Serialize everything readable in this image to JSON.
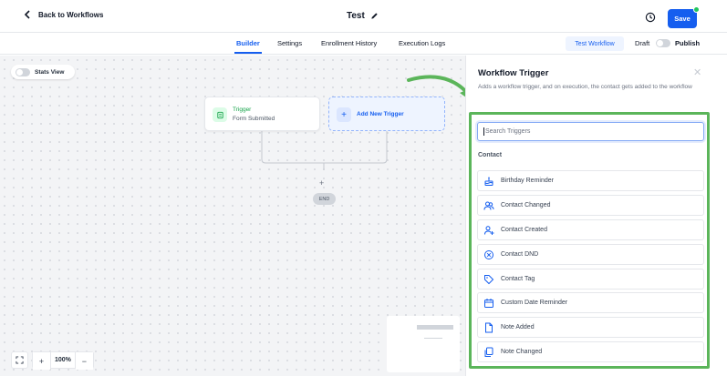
{
  "header": {
    "back_label": "Back to Workflows",
    "title": "Test",
    "save_label": "Save"
  },
  "tabs": [
    {
      "label": "Builder",
      "active": true
    },
    {
      "label": "Settings"
    },
    {
      "label": "Enrollment History"
    },
    {
      "label": "Execution Logs"
    }
  ],
  "actions": {
    "test_workflow": "Test Workflow",
    "draft": "Draft",
    "publish": "Publish"
  },
  "canvas": {
    "stats_view": "Stats View",
    "trigger_node": {
      "title": "Trigger",
      "subtitle": "Form Submitted"
    },
    "add_trigger": "Add New Trigger",
    "end_label": "END",
    "zoom_level": "100%"
  },
  "panel": {
    "title": "Workflow Trigger",
    "description": "Adds a workflow trigger, and on execution, the contact gets added to the workflow",
    "search_placeholder": "Search Triggers",
    "section": "Contact",
    "items": [
      {
        "label": "Birthday Reminder",
        "icon": "cake-icon"
      },
      {
        "label": "Contact Changed",
        "icon": "users-icon"
      },
      {
        "label": "Contact Created",
        "icon": "user-plus-icon"
      },
      {
        "label": "Contact DND",
        "icon": "dnd-icon"
      },
      {
        "label": "Contact Tag",
        "icon": "tag-icon"
      },
      {
        "label": "Custom Date Reminder",
        "icon": "calendar-icon"
      },
      {
        "label": "Note Added",
        "icon": "file-icon"
      },
      {
        "label": "Note Changed",
        "icon": "note-copy-icon"
      }
    ]
  },
  "colors": {
    "accent": "#155eef",
    "green": "#16a34a",
    "highlight": "#5bb55a"
  }
}
